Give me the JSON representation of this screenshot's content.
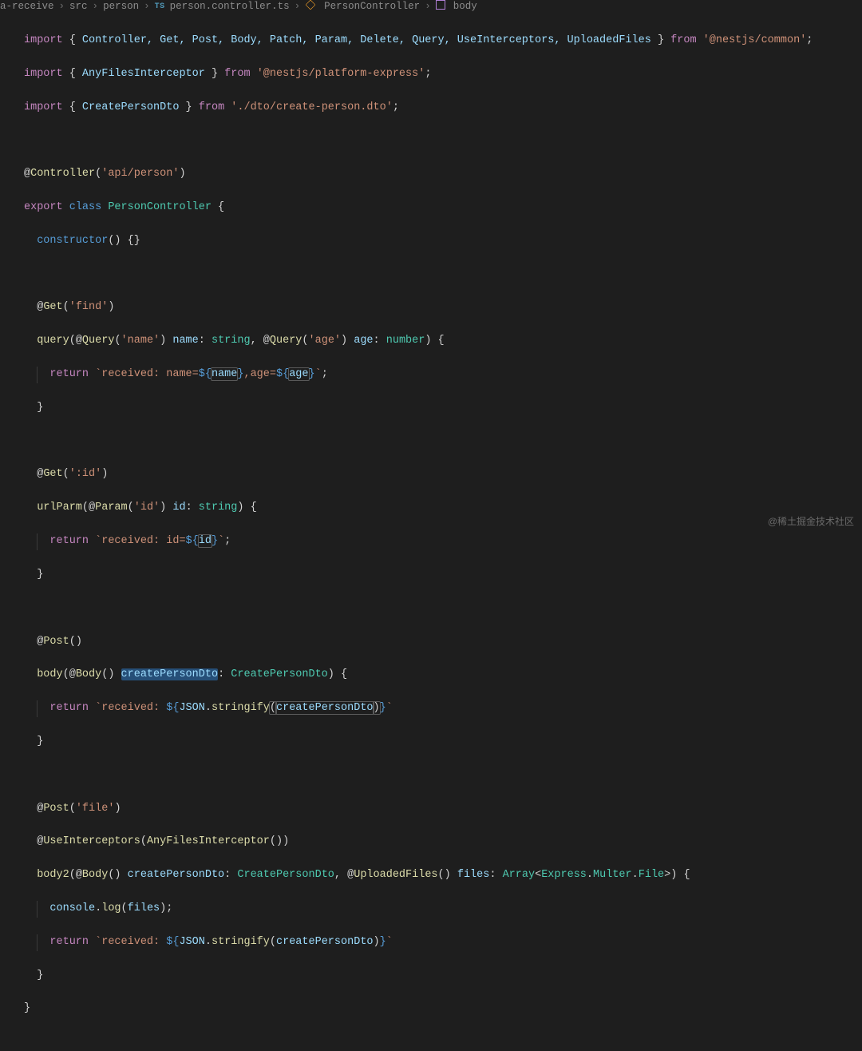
{
  "breadcrumbs": {
    "b0": "a-receive",
    "b1": "src",
    "b2": "person",
    "ts": "TS",
    "b3": "person.controller.ts",
    "b4": "PersonController",
    "b5": "body"
  },
  "code": {
    "l1": {
      "import": "import",
      "lb": " { ",
      "ids": "Controller, Get, Post, Body, Patch, Param, Delete, Query, UseInterceptors, UploadedFiles",
      "rb": " } ",
      "from": "from ",
      "str": "'@nestjs/common'",
      "sc": ";"
    },
    "l2": {
      "import": "import",
      "lb": " { ",
      "ids": "AnyFilesInterceptor",
      "rb": " } ",
      "from": "from ",
      "str": "'@nestjs/platform-express'",
      "sc": ";"
    },
    "l3": {
      "import": "import",
      "lb": " { ",
      "ids": "CreatePersonDto",
      "rb": " } ",
      "from": "from ",
      "str": "'./dto/create-person.dto'",
      "sc": ";"
    },
    "l5a": "@",
    "l5b": "Controller",
    "l5c": "(",
    "l5d": "'api/person'",
    "l5e": ")",
    "l6a": "export ",
    "l6b": "class ",
    "l6c": "PersonController",
    "l6d": " {",
    "l7a": "constructor",
    "l7b": "() {}",
    "l9a": "@",
    "l9b": "Get",
    "l9c": "(",
    "l9d": "'find'",
    "l9e": ")",
    "l10a": "query",
    "l10b": "(@",
    "l10c": "Query",
    "l10d": "(",
    "l10e": "'name'",
    "l10f": ") ",
    "l10g": "name",
    "l10h": ": ",
    "l10i": "string",
    "l10j": ", @",
    "l10k": "Query",
    "l10l": "(",
    "l10m": "'age'",
    "l10n": ") ",
    "l10o": "age",
    "l10p": ": ",
    "l10q": "number",
    "l10r": ") {",
    "l11a": "return ",
    "l11b": "`received: name=",
    "l11c": "${",
    "l11d": "name",
    "l11e": "}",
    "l11f": ",age=",
    "l11g": "${",
    "l11h": "age",
    "l11i": "}",
    "l11j": "`",
    "l11k": ";",
    "l12": "}",
    "l14a": "@",
    "l14b": "Get",
    "l14c": "(",
    "l14d": "':id'",
    "l14e": ")",
    "l15a": "urlParm",
    "l15b": "(@",
    "l15c": "Param",
    "l15d": "(",
    "l15e": "'id'",
    "l15f": ") ",
    "l15g": "id",
    "l15h": ": ",
    "l15i": "string",
    "l15j": ") {",
    "l16a": "return ",
    "l16b": "`received: id=",
    "l16c": "${",
    "l16d": "id",
    "l16e": "}",
    "l16f": "`",
    "l16g": ";",
    "l17": "}",
    "l19a": "@",
    "l19b": "Post",
    "l19c": "()",
    "l20a": "body",
    "l20b": "(@",
    "l20c": "Body",
    "l20d": "() ",
    "l20e": "createPersonDto",
    "l20f": ": ",
    "l20g": "CreatePersonDto",
    "l20h": ") {",
    "l21a": "return ",
    "l21b": "`received: ",
    "l21c": "${",
    "l21d": "JSON",
    "l21e": ".",
    "l21f": "stringify",
    "l21g": "(",
    "l21h": "createPersonDto",
    "l21i": ")",
    "l21j": "}",
    "l21k": "`",
    "l22": "}",
    "l24a": "@",
    "l24b": "Post",
    "l24c": "(",
    "l24d": "'file'",
    "l24e": ")",
    "l25a": "@",
    "l25b": "UseInterceptors",
    "l25c": "(",
    "l25d": "AnyFilesInterceptor",
    "l25e": "())",
    "l26a": "body2",
    "l26b": "(@",
    "l26c": "Body",
    "l26d": "() ",
    "l26e": "createPersonDto",
    "l26f": ": ",
    "l26g": "CreatePersonDto",
    "l26h": ", @",
    "l26i": "UploadedFiles",
    "l26j": "() ",
    "l26k": "files",
    "l26l": ": ",
    "l26m": "Array",
    "l26n": "<",
    "l26o": "Express",
    "l26p": ".",
    "l26q": "Multer",
    "l26r": ".",
    "l26s": "File",
    "l26t": ">) {",
    "l27a": "console",
    "l27b": ".",
    "l27c": "log",
    "l27d": "(",
    "l27e": "files",
    "l27f": ");",
    "l28a": "return ",
    "l28b": "`received: ",
    "l28c": "${",
    "l28d": "JSON",
    "l28e": ".",
    "l28f": "stringify",
    "l28g": "(",
    "l28h": "createPersonDto",
    "l28i": ")",
    "l28j": "}",
    "l28k": "`",
    "l29": "}",
    "l30": "}"
  },
  "watermark": "@稀土掘金技术社区"
}
